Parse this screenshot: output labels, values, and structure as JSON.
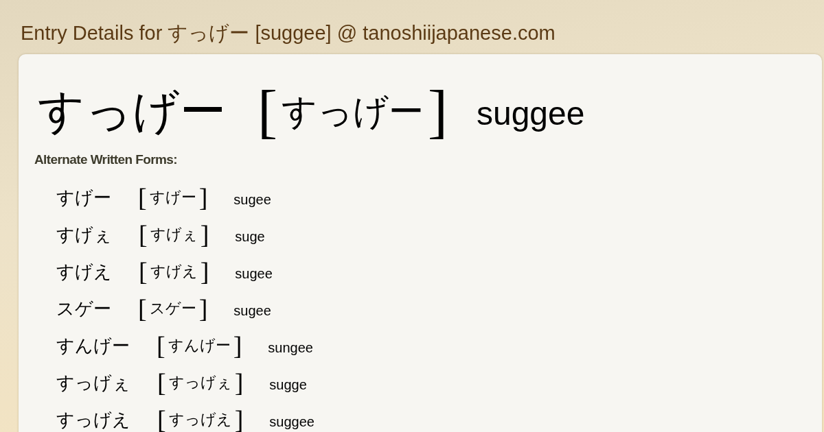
{
  "page_title": "Entry Details for すっげー [suggee] @ tanoshiijapanese.com",
  "entry": {
    "word": "すっげー",
    "open_bracket": "[",
    "reading": "すっげー",
    "close_bracket": "]",
    "romaji": "suggee"
  },
  "alternate_forms": {
    "heading": "Alternate Written Forms:",
    "items": [
      {
        "word": "すげー",
        "open_bracket": "[",
        "reading": "すげー",
        "close_bracket": "]",
        "romaji": "sugee"
      },
      {
        "word": "すげぇ",
        "open_bracket": "[",
        "reading": "すげぇ",
        "close_bracket": "]",
        "romaji": "suge"
      },
      {
        "word": "すげえ",
        "open_bracket": "[",
        "reading": "すげえ",
        "close_bracket": "]",
        "romaji": "sugee"
      },
      {
        "word": "スゲー",
        "open_bracket": "[",
        "reading": "スゲー",
        "close_bracket": "]",
        "romaji": "sugee"
      },
      {
        "word": "すんげー",
        "open_bracket": "[",
        "reading": "すんげー",
        "close_bracket": "]",
        "romaji": "sungee"
      },
      {
        "word": "すっげぇ",
        "open_bracket": "[",
        "reading": "すっげぇ",
        "close_bracket": "]",
        "romaji": "sugge"
      },
      {
        "word": "すっげえ",
        "open_bracket": "[",
        "reading": "すっげえ",
        "close_bracket": "]",
        "romaji": "suggee"
      }
    ]
  }
}
